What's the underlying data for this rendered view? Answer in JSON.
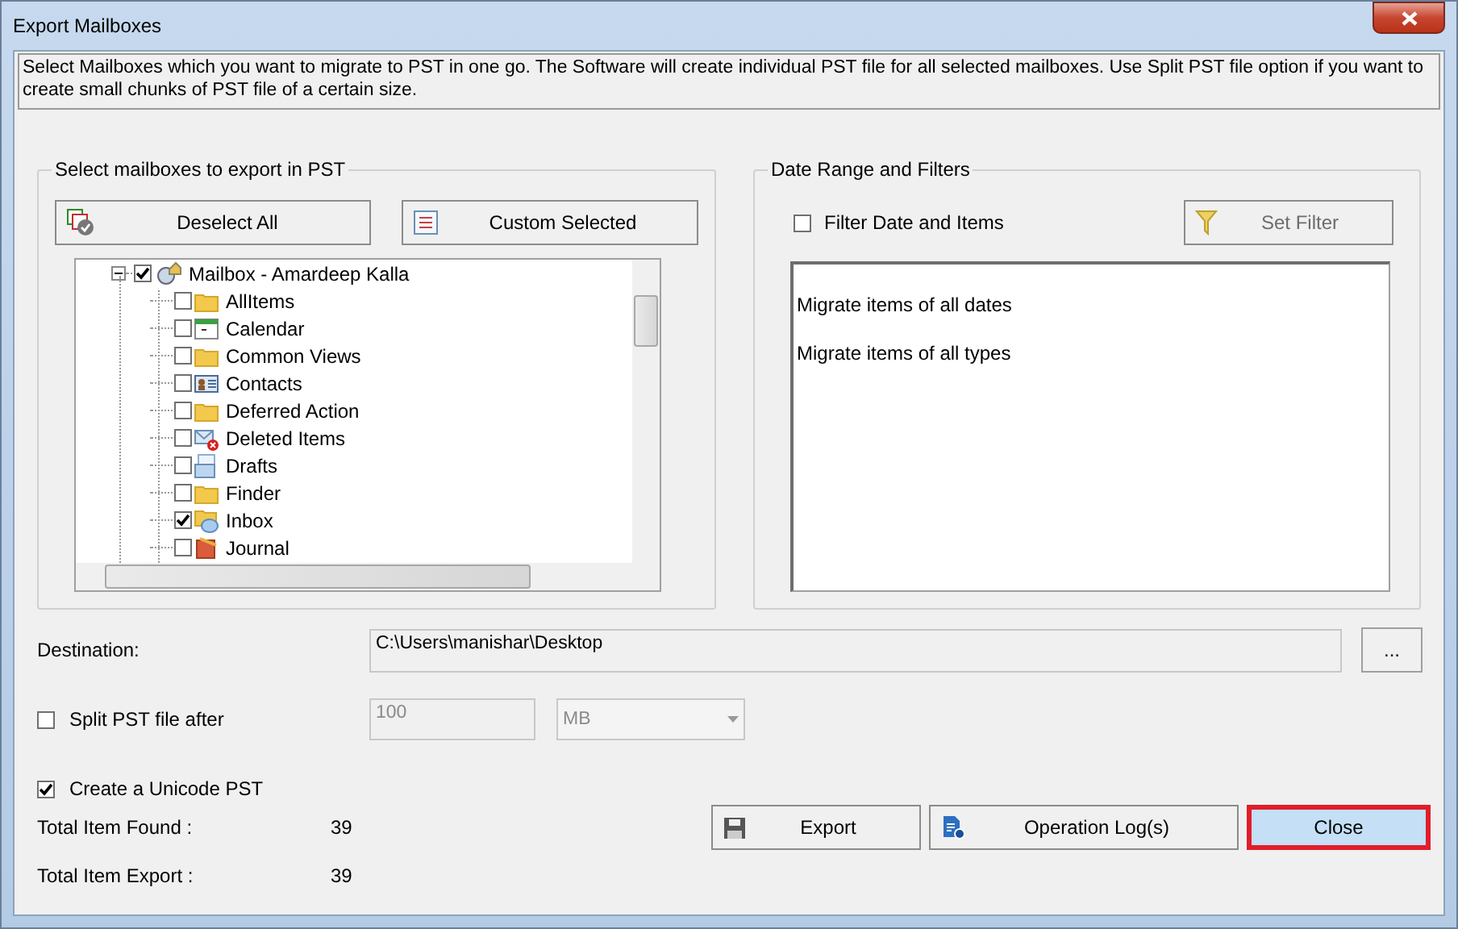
{
  "window": {
    "title": "Export Mailboxes"
  },
  "description": "Select Mailboxes which you want to migrate to PST in one go. The Software will create individual PST file for all selected mailboxes. Use Split PST file option if you want to create small chunks of PST file of a certain size.",
  "mailbox_group": {
    "title": "Select mailboxes to export in PST",
    "buttons": [
      {
        "label": "Deselect All",
        "kind": "deselect"
      },
      {
        "label": "Custom Selected",
        "kind": "custom"
      }
    ],
    "tree": {
      "label": "Mailbox - Amardeep Kalla",
      "checked": true,
      "expanded": true,
      "children": [
        {
          "label": "AllItems",
          "kind": "folder",
          "checked": false
        },
        {
          "label": "Calendar",
          "kind": "calendar",
          "checked": false
        },
        {
          "label": "Common Views",
          "kind": "folder",
          "checked": false
        },
        {
          "label": "Contacts",
          "kind": "contacts",
          "checked": false
        },
        {
          "label": "Deferred Action",
          "kind": "folder",
          "checked": false
        },
        {
          "label": "Deleted Items",
          "kind": "deleted",
          "checked": false
        },
        {
          "label": "Drafts",
          "kind": "drafts",
          "checked": false
        },
        {
          "label": "Finder",
          "kind": "folder",
          "checked": false
        },
        {
          "label": "Inbox",
          "kind": "inbox",
          "checked": true
        },
        {
          "label": "Journal",
          "kind": "journal",
          "checked": false
        }
      ]
    }
  },
  "filter_group": {
    "title": "Date Range and Filters",
    "filter_checkbox": {
      "label": "Filter Date and Items",
      "checked": false
    },
    "set_filter": {
      "label": "Set Filter",
      "disabled": true
    },
    "summary": [
      "Migrate items of all dates",
      "Migrate items of all types"
    ]
  },
  "destination": {
    "label": "Destination:",
    "value": "C:\\Users\\manishar\\Desktop",
    "browse": "..."
  },
  "split": {
    "label": "Split PST file after",
    "checked": false,
    "size": "100",
    "unit": "MB"
  },
  "unicode": {
    "label": "Create a Unicode PST",
    "checked": true
  },
  "totals": [
    {
      "label": "Total Item Found :",
      "value": "39"
    },
    {
      "label": "Total Item Export :",
      "value": "39"
    }
  ],
  "actions": [
    {
      "label": "Export",
      "kind": "export",
      "highlighted": false
    },
    {
      "label": "Operation Log(s)",
      "kind": "log",
      "highlighted": false
    },
    {
      "label": "Close",
      "kind": "close",
      "highlighted": true
    }
  ]
}
